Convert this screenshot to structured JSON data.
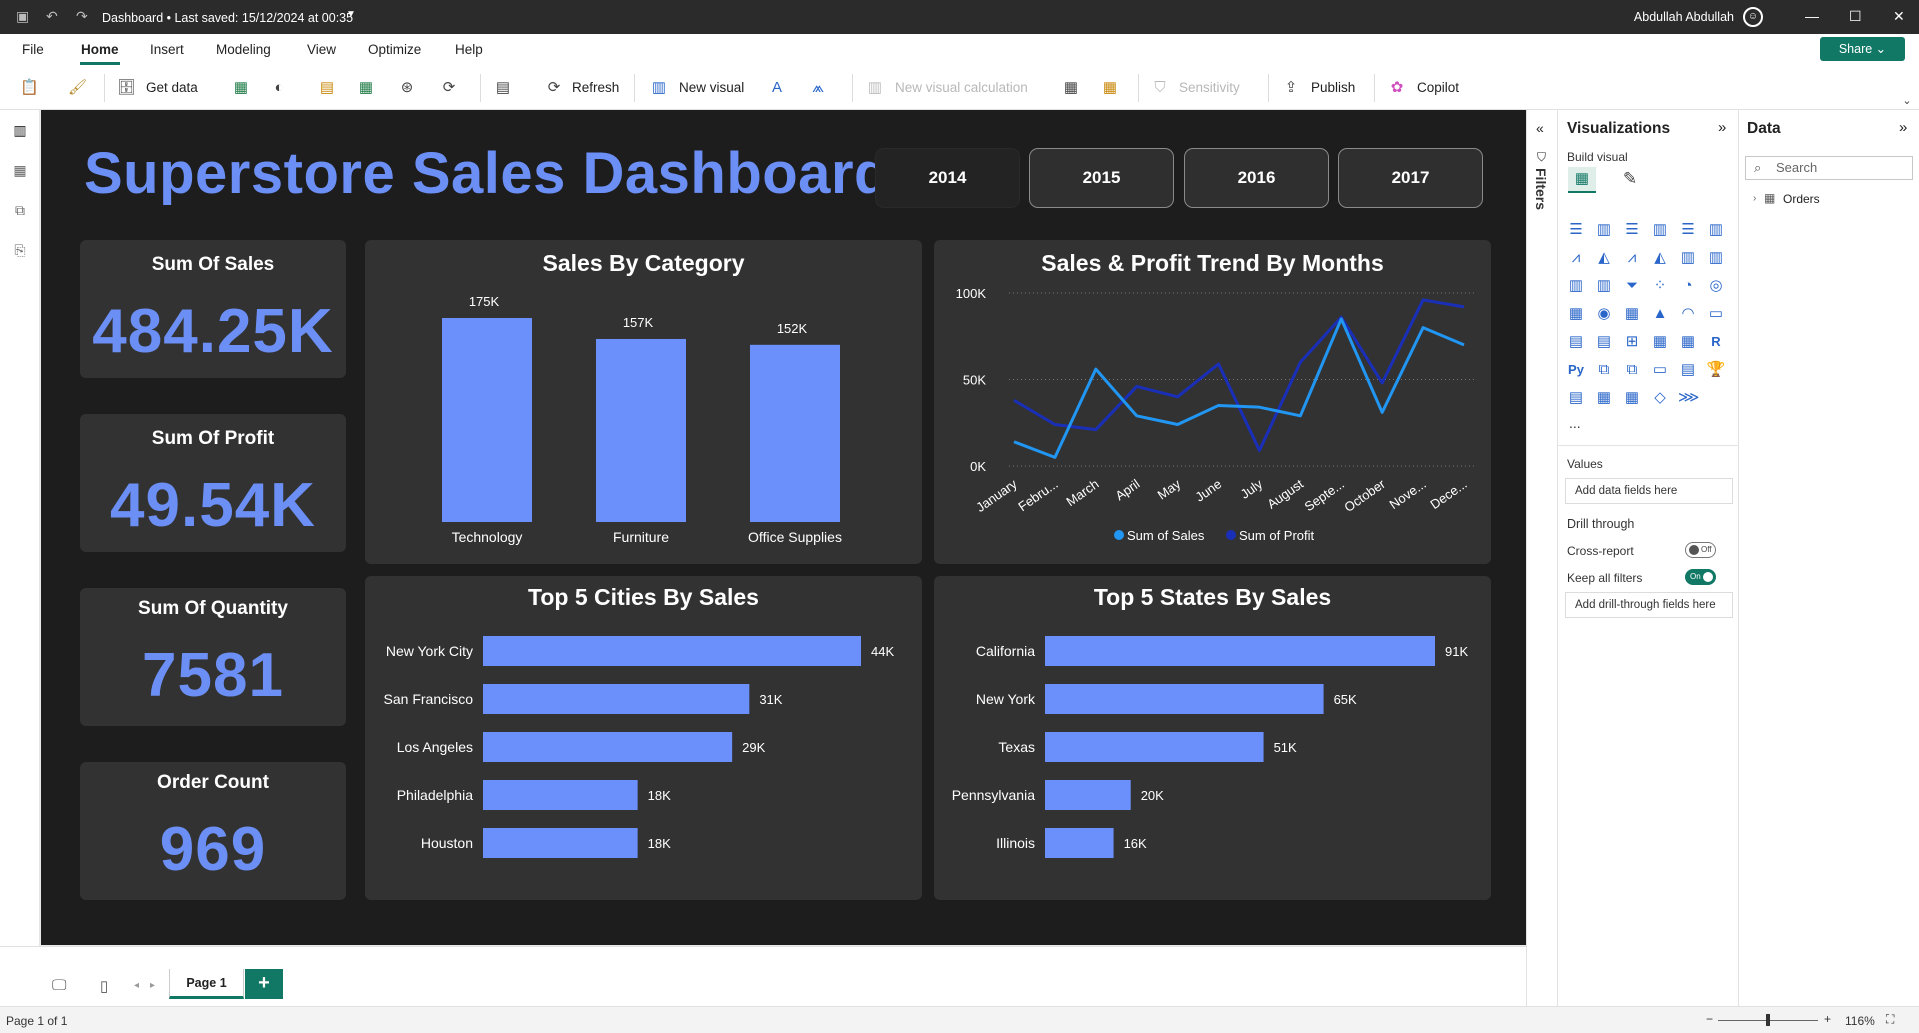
{
  "titlebar": {
    "doc_title": "Dashboard • Last saved: 15/12/2024 at 00:35",
    "user": "Abdullah Abdullah"
  },
  "menu": {
    "items": [
      "File",
      "Home",
      "Insert",
      "Modeling",
      "View",
      "Optimize",
      "Help"
    ],
    "share": "Share"
  },
  "ribbon": {
    "get_data": "Get data",
    "refresh": "Refresh",
    "new_visual": "New visual",
    "new_visual_calc": "New visual calculation",
    "sensitivity": "Sensitivity",
    "publish": "Publish",
    "copilot": "Copilot"
  },
  "report": {
    "title": "Superstore Sales Dashboard",
    "years": [
      "2014",
      "2015",
      "2016",
      "2017"
    ],
    "selected_year": "2014",
    "kpis": [
      {
        "label": "Sum Of Sales",
        "value": "484.25K"
      },
      {
        "label": "Sum Of Profit",
        "value": "49.54K"
      },
      {
        "label": "Sum Of Quantity",
        "value": "7581"
      },
      {
        "label": "Order Count",
        "value": "969"
      }
    ]
  },
  "colors": {
    "accent": "#6c8ff5",
    "bar": "#6b8ffb",
    "profit_line": "#1a2fb8",
    "sales_line": "#2196f3",
    "background": "#1d1d1d",
    "card": "#323232",
    "theme_green": "#117865"
  },
  "chart_data": [
    {
      "type": "bar",
      "title": "Sales By Category",
      "categories": [
        "Technology",
        "Furniture",
        "Office Supplies"
      ],
      "values": [
        175,
        157,
        152
      ],
      "labels": [
        "175K",
        "157K",
        "152K"
      ],
      "ylim": [
        0,
        175
      ]
    },
    {
      "type": "line",
      "title": "Sales & Profit Trend By Months",
      "categories": [
        "January",
        "Febru...",
        "March",
        "April",
        "May",
        "June",
        "July",
        "August",
        "Septe...",
        "October",
        "Nove...",
        "Dece..."
      ],
      "yticks": [
        "100K",
        "50K",
        "0K"
      ],
      "ylim": [
        0,
        100
      ],
      "series": [
        {
          "name": "Sum of Sales",
          "color": "#2196f3",
          "values": [
            14,
            5,
            56,
            29,
            24,
            35,
            34,
            29,
            85,
            31,
            80,
            70
          ]
        },
        {
          "name": "Sum of Profit",
          "color": "#1a2fb8",
          "values": [
            38,
            24,
            21,
            46,
            40,
            59,
            9,
            60,
            86,
            48,
            96,
            92
          ]
        }
      ],
      "legend": "bottom"
    },
    {
      "type": "bar",
      "orientation": "horizontal",
      "title": "Top 5 Cities By Sales",
      "categories": [
        "New York City",
        "San Francisco",
        "Los Angeles",
        "Philadelphia",
        "Houston"
      ],
      "values": [
        44,
        31,
        29,
        18,
        18
      ],
      "labels": [
        "44K",
        "31K",
        "29K",
        "18K",
        "18K"
      ]
    },
    {
      "type": "bar",
      "orientation": "horizontal",
      "title": "Top 5 States By Sales",
      "categories": [
        "California",
        "New York",
        "Texas",
        "Pennsylvania",
        "Illinois"
      ],
      "values": [
        91,
        65,
        51,
        20,
        16
      ],
      "labels": [
        "91K",
        "65K",
        "51K",
        "20K",
        "16K"
      ]
    }
  ],
  "pages": {
    "tab": "Page 1",
    "status": "Page 1 of 1",
    "zoom": "116%"
  },
  "filters": {
    "label": "Filters"
  },
  "visualizations": {
    "title": "Visualizations",
    "build_visual": "Build visual",
    "more": "...",
    "values_label": "Values",
    "values_well": "Add data fields here",
    "drill_through": "Drill through",
    "cross_report": "Cross-report",
    "cross_report_state": "Off",
    "keep_filters": "Keep all filters",
    "keep_filters_state": "On",
    "drill_well": "Add drill-through fields here"
  },
  "data_pane": {
    "title": "Data",
    "search_placeholder": "Search",
    "tables": [
      "Orders"
    ]
  }
}
